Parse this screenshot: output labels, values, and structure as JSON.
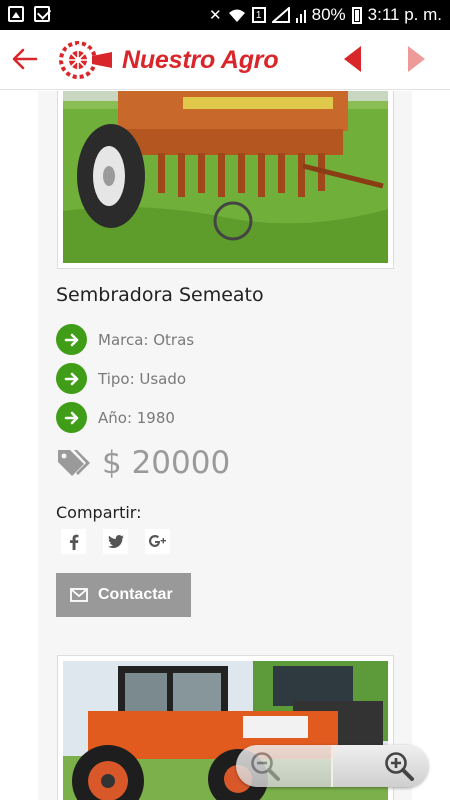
{
  "status_bar": {
    "battery": "80%",
    "time": "3:11 p. m.",
    "sim_badge": "1",
    "icons": [
      "image-notification-icon",
      "mail-icon",
      "mute-icon",
      "wifi-icon",
      "signal-icon",
      "battery-icon"
    ]
  },
  "header": {
    "brand": "Nuestro Agro",
    "icons": [
      "back-arrow-icon",
      "logo-icon",
      "prev-triangle-icon",
      "next-triangle-icon"
    ],
    "colors": {
      "brand_red": "#d9262a",
      "next_disabled": "#ee9a98"
    }
  },
  "listing": {
    "title": "Sembradora Semeato",
    "specs": [
      {
        "label": "Marca: Otras"
      },
      {
        "label": "Tipo: Usado"
      },
      {
        "label": "Año: 1980"
      }
    ],
    "price": "$ 20000",
    "share_label": "Compartir:",
    "share_buttons": [
      {
        "icon": "facebook-icon",
        "glyph": "f"
      },
      {
        "icon": "twitter-icon",
        "glyph": "t"
      },
      {
        "icon": "google-plus-icon",
        "glyph": "g+"
      }
    ],
    "contact_label": "Contactar",
    "colors": {
      "spec_green": "#3f9d17",
      "button_gray": "#999999"
    }
  },
  "zoom": {
    "icons": [
      "zoom-out-icon",
      "zoom-in-icon"
    ]
  }
}
